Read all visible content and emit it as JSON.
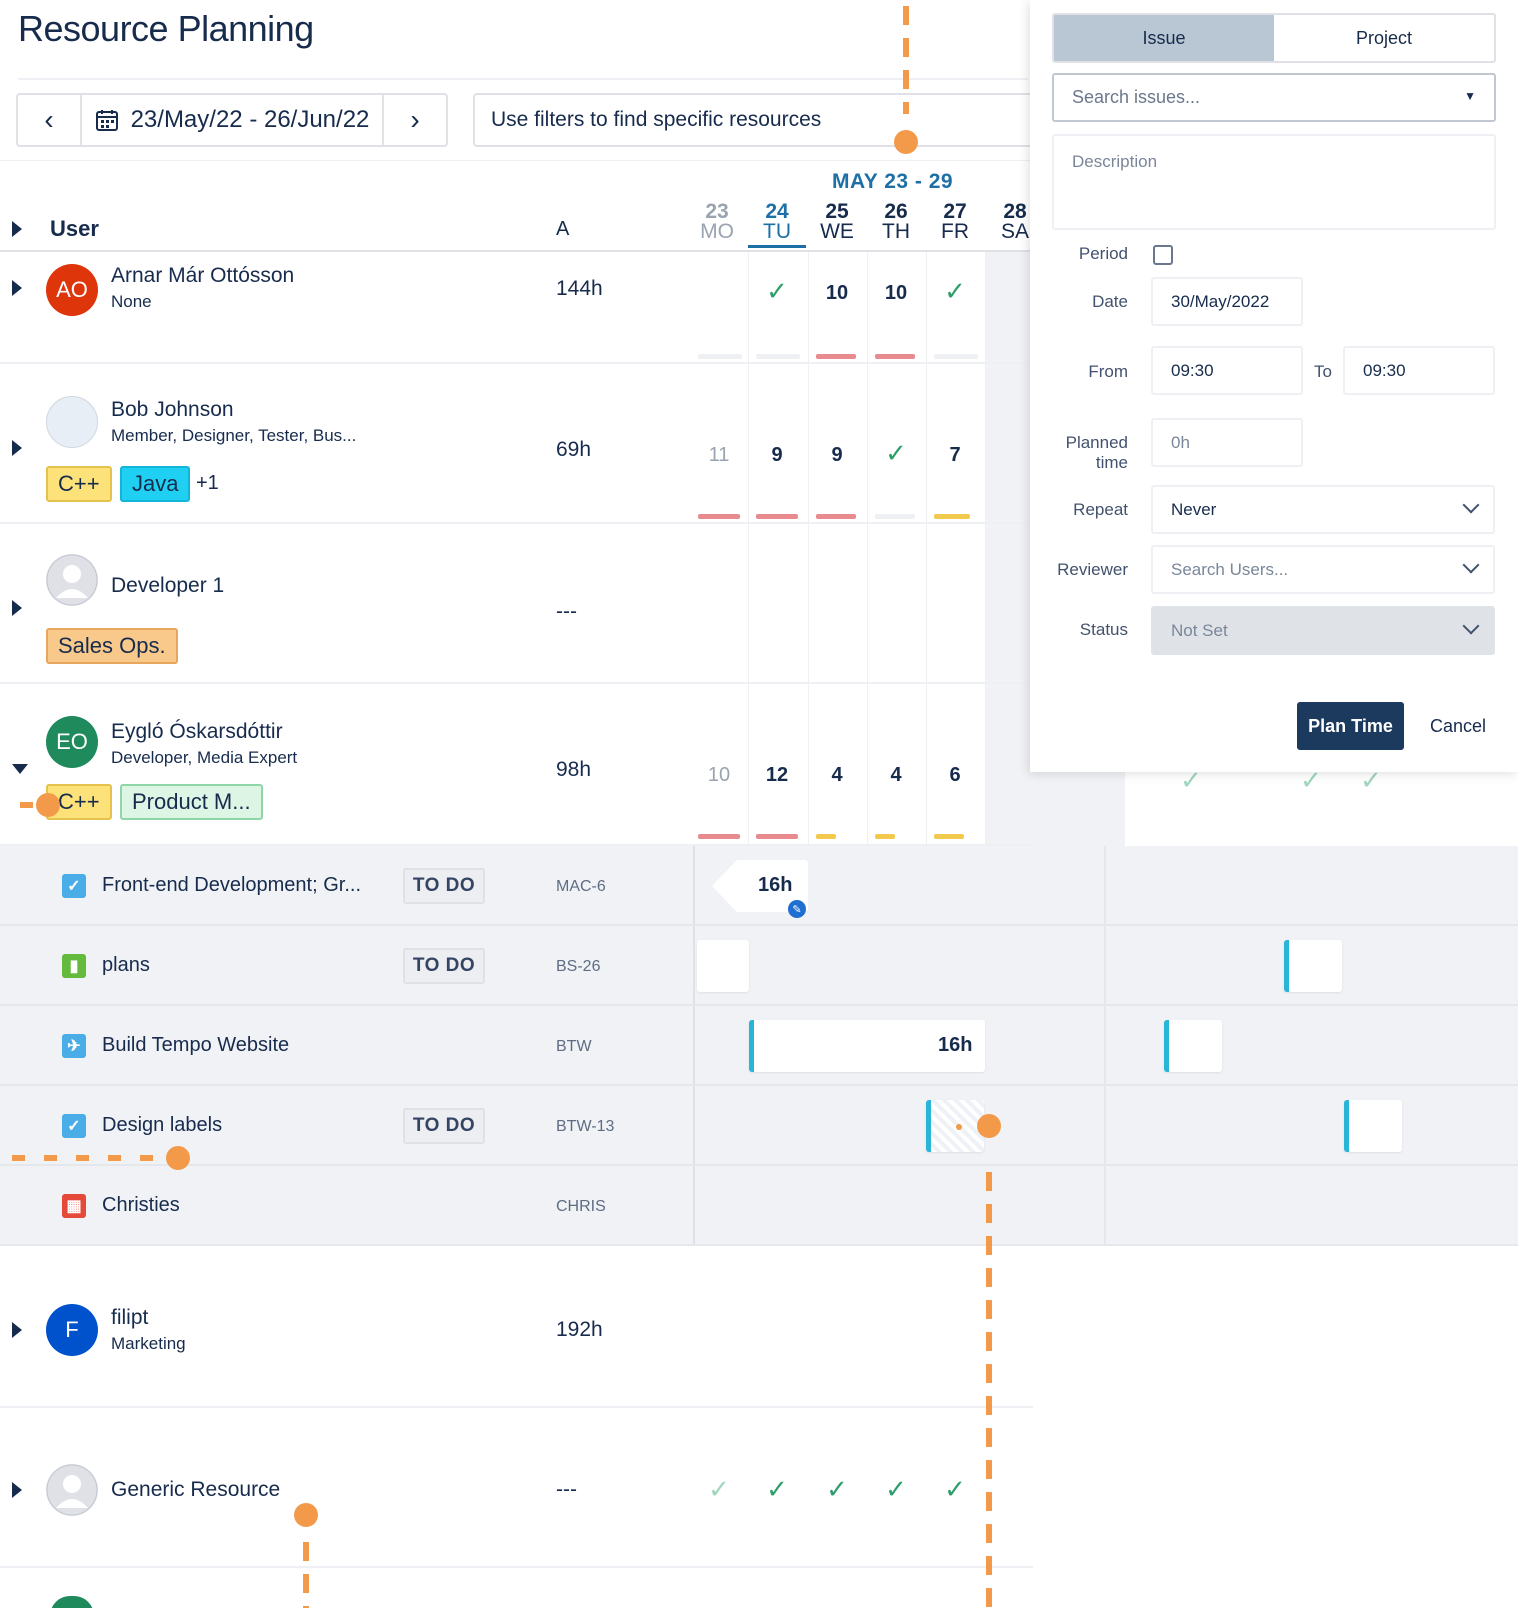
{
  "header": {
    "title": "Resource Planning",
    "date_range": "23/May/22 - 26/Jun/22",
    "filter_placeholder": "Use filters to find specific resources"
  },
  "grid": {
    "week_label": "MAY 23 - 29",
    "user_col_label": "User",
    "a_col_label": "A",
    "days": [
      {
        "num": "23",
        "name": "MO"
      },
      {
        "num": "24",
        "name": "TU"
      },
      {
        "num": "25",
        "name": "WE"
      },
      {
        "num": "26",
        "name": "TH"
      },
      {
        "num": "27",
        "name": "FR"
      },
      {
        "num": "28",
        "name": "SA"
      }
    ]
  },
  "users": [
    {
      "initials": "AO",
      "name": "Arnar Már Ottósson",
      "role": "None",
      "hours": "144h",
      "cells": [
        "",
        "✓",
        "10",
        "10",
        "✓"
      ]
    },
    {
      "name": "Bob Johnson",
      "role": "Member, Designer, Tester, Bus...",
      "hours": "69h",
      "tags": [
        "C++",
        "Java"
      ],
      "more": "+1",
      "cells": [
        "11",
        "9",
        "9",
        "✓",
        "7"
      ]
    },
    {
      "name": "Developer 1",
      "hours": "---",
      "tags": [
        "Sales Ops."
      ]
    },
    {
      "initials": "EO",
      "name": "Eygló Óskarsdóttir",
      "role": "Developer, Media Expert",
      "hours": "98h",
      "tags": [
        "C++",
        "Product M..."
      ],
      "cells": [
        "10",
        "12",
        "4",
        "4",
        "6"
      ]
    },
    {
      "initials": "F",
      "name": "filipt",
      "role": "Marketing",
      "hours": "192h"
    },
    {
      "name": "Generic Resource",
      "hours": "---"
    }
  ],
  "tasks": [
    {
      "name": "Front-end Development; Gr...",
      "status": "TO DO",
      "key": "MAC-6",
      "planned": "16h",
      "icon": "checkbox-icon"
    },
    {
      "name": "plans",
      "status": "TO DO",
      "key": "BS-26",
      "icon": "bookmark-icon"
    },
    {
      "name": "Build Tempo Website",
      "key": "BTW",
      "planned": "16h",
      "icon": "project-icon"
    },
    {
      "name": "Design labels",
      "status": "TO DO",
      "key": "BTW-13",
      "icon": "checkbox-icon"
    },
    {
      "name": "Christies",
      "key": "CHRIS",
      "icon": "project-icon"
    }
  ],
  "panel": {
    "tab_issue": "Issue",
    "tab_project": "Project",
    "search_placeholder": "Search issues...",
    "description_placeholder": "Description",
    "period_label": "Period",
    "date_label": "Date",
    "date_value": "30/May/2022",
    "from_label": "From",
    "from_value": "09:30",
    "to_label": "To",
    "to_value": "09:30",
    "planned_label_1": "Planned",
    "planned_label_2": "time",
    "planned_value": "0h",
    "repeat_label": "Repeat",
    "repeat_value": "Never",
    "reviewer_label": "Reviewer",
    "reviewer_placeholder": "Search Users...",
    "status_label": "Status",
    "status_value": "Not Set",
    "plan_button": "Plan Time",
    "cancel_button": "Cancel"
  },
  "colors": {
    "accent": "#1d6fa5",
    "primary_button": "#1b3a5e",
    "marker": "#f39a4a",
    "over_bar": "#e98a8f",
    "under_bar": "#f2c94c",
    "check": "#2e9e6b"
  }
}
